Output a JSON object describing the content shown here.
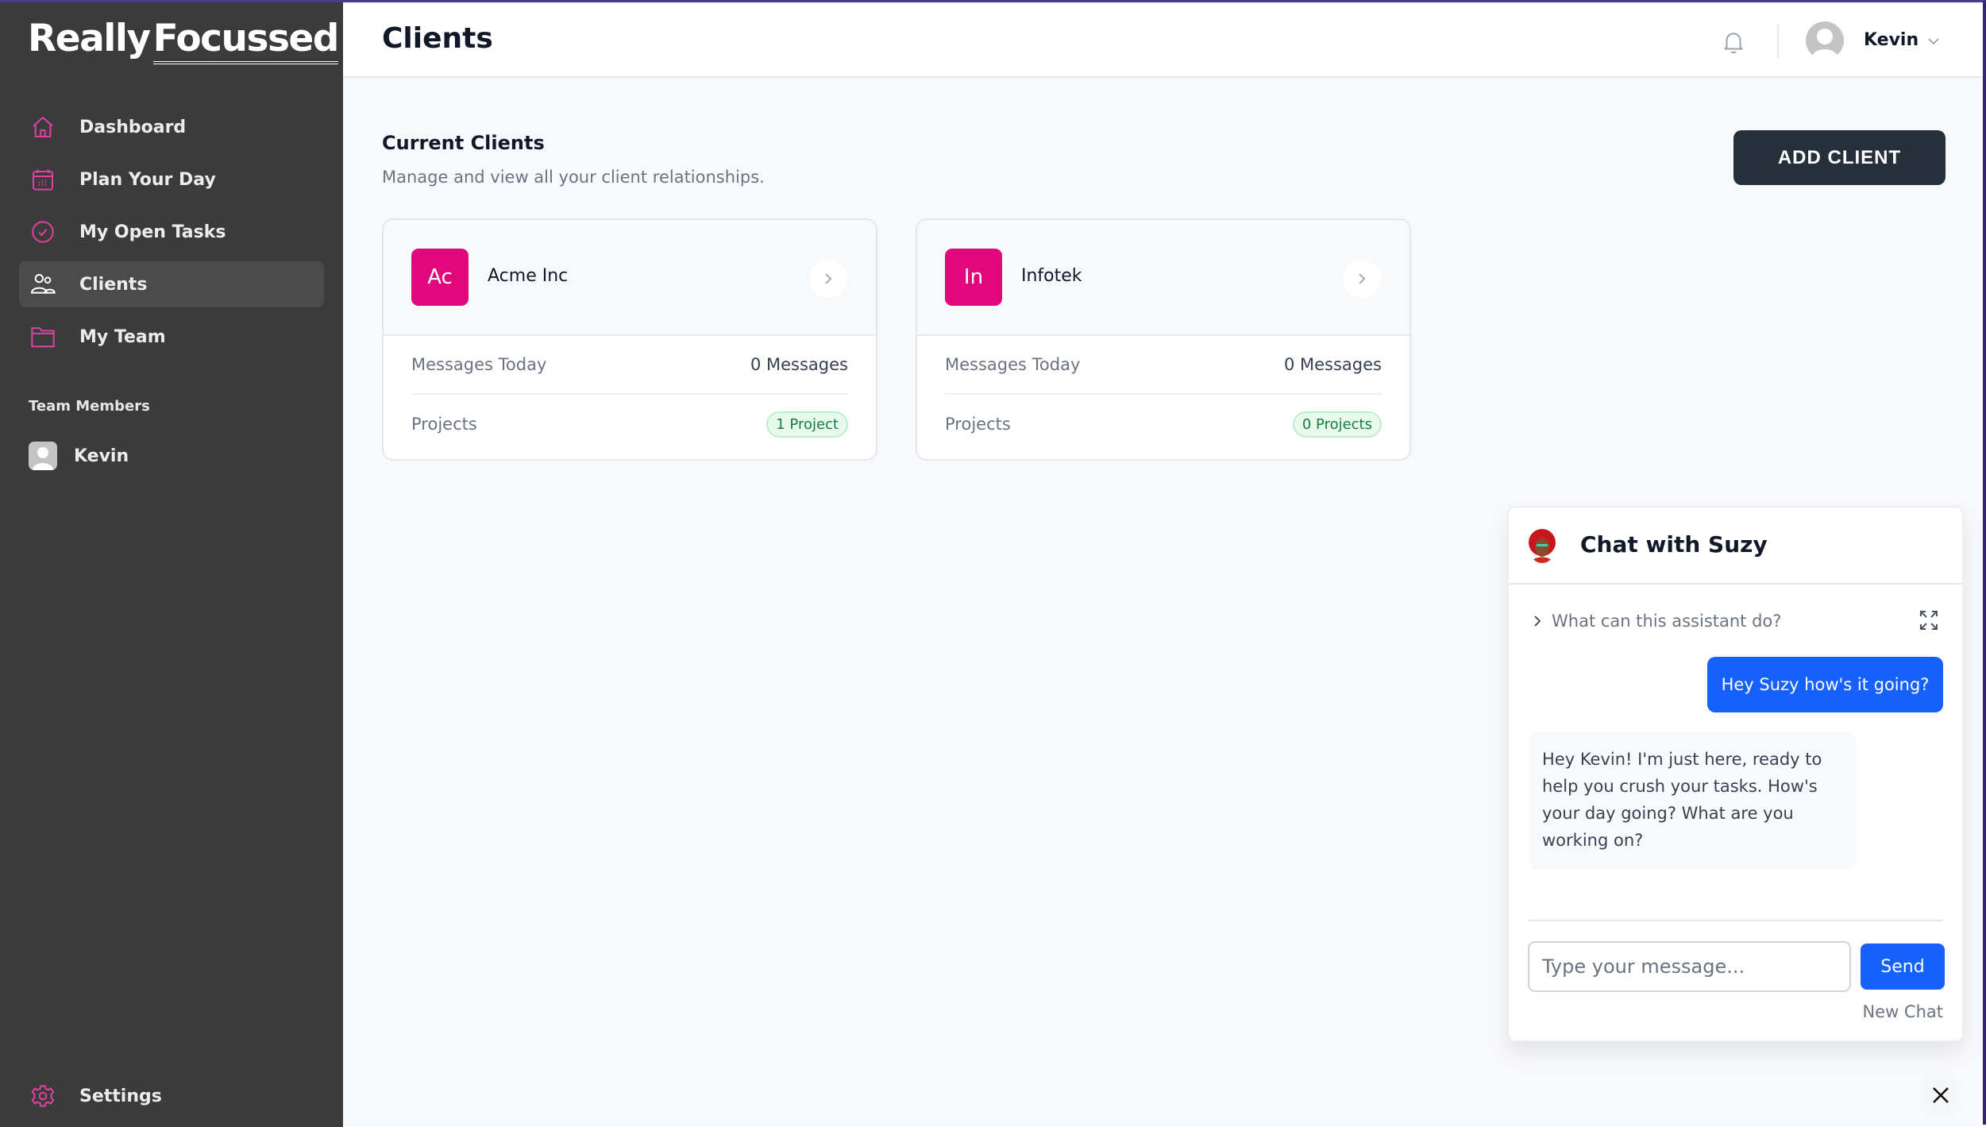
{
  "brand": {
    "part1": "Really",
    "part2": "Focussed"
  },
  "sidebar": {
    "items": [
      {
        "label": "Dashboard",
        "icon": "home-icon"
      },
      {
        "label": "Plan Your Day",
        "icon": "calendar-icon"
      },
      {
        "label": "My Open Tasks",
        "icon": "check-circle-icon"
      },
      {
        "label": "Clients",
        "icon": "users-icon",
        "active": true
      },
      {
        "label": "My Team",
        "icon": "folder-icon"
      }
    ],
    "team_label": "Team Members",
    "team_members": [
      {
        "name": "Kevin"
      }
    ],
    "settings_label": "Settings"
  },
  "header": {
    "title": "Clients",
    "user_name": "Kevin"
  },
  "main": {
    "section_title": "Current Clients",
    "section_subtitle": "Manage and view all your client relationships.",
    "add_client_label": "ADD CLIENT",
    "clients": [
      {
        "initials": "Ac",
        "name": "Acme Inc",
        "messages_label": "Messages Today",
        "messages_value": "0 Messages",
        "projects_label": "Projects",
        "projects_value": "1 Project"
      },
      {
        "initials": "In",
        "name": "Infotek",
        "messages_label": "Messages Today",
        "messages_value": "0 Messages",
        "projects_label": "Projects",
        "projects_value": "0 Projects"
      }
    ]
  },
  "chat": {
    "title": "Chat with Suzy",
    "help_label": "What can this assistant do?",
    "messages": [
      {
        "from": "user",
        "text": "Hey Suzy how's it going?"
      },
      {
        "from": "assistant",
        "text": "Hey Kevin! I'm just here, ready to help you crush your tasks. How's your day going? What are you working on?"
      }
    ],
    "input_placeholder": "Type your message...",
    "input_value": "",
    "send_label": "Send",
    "new_chat_label": "New Chat"
  },
  "colors": {
    "accent_pink": "#e0087a",
    "icon_pink": "#e040a0",
    "primary_blue": "#1660fb",
    "sidebar_bg": "#3b3b3b",
    "dark_button": "#26303a"
  }
}
